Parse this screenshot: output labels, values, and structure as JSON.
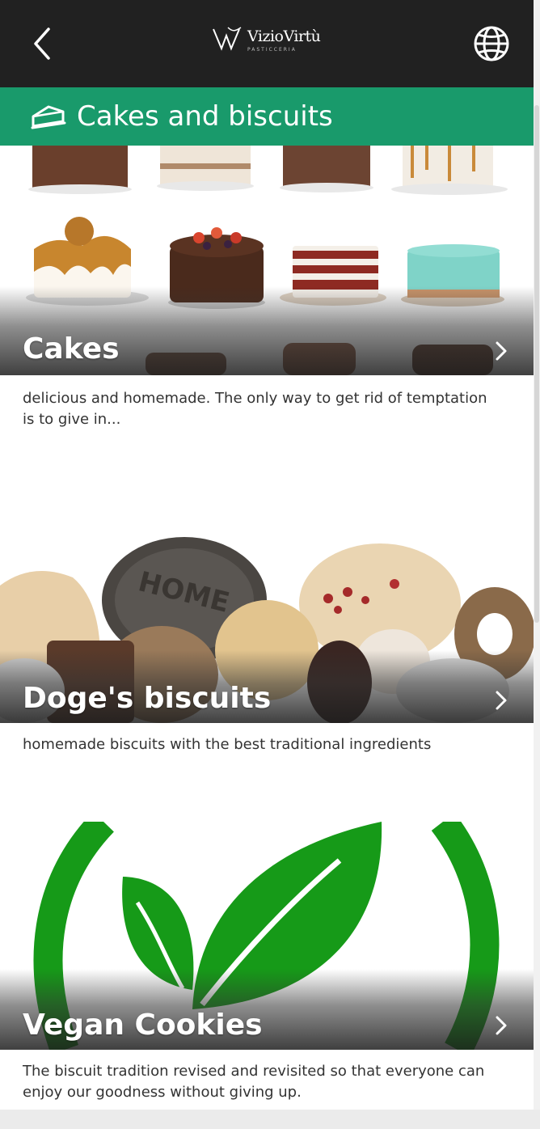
{
  "topbar": {
    "back_icon": "chevron-left-icon",
    "logo_name": "VizioVirtù",
    "logo_sub": "PASTICCERIA",
    "globe_icon": "globe-icon",
    "background": "#212121"
  },
  "category": {
    "icon": "cake-slice-icon",
    "title": "Cakes and biscuits",
    "color": "#199a6b"
  },
  "cards": [
    {
      "title": "Cakes",
      "description": "delicious and homemade. The only way to get rid of temptation is to give in...",
      "image": "cakes-photo",
      "chevron": "chevron-right-icon"
    },
    {
      "title": "Doge's biscuits",
      "description": "homemade biscuits with the best traditional ingredients",
      "image": "biscuits-photo",
      "chevron": "chevron-right-icon"
    },
    {
      "title": "Vegan Cookies",
      "description": "The biscuit tradition revised and revisited so that everyone can enjoy our goodness without giving up.",
      "image": "vegan-leaf-logo",
      "chevron": "chevron-right-icon"
    }
  ],
  "colors": {
    "vegan_green": "#169a18",
    "accent": "#199a6b"
  }
}
